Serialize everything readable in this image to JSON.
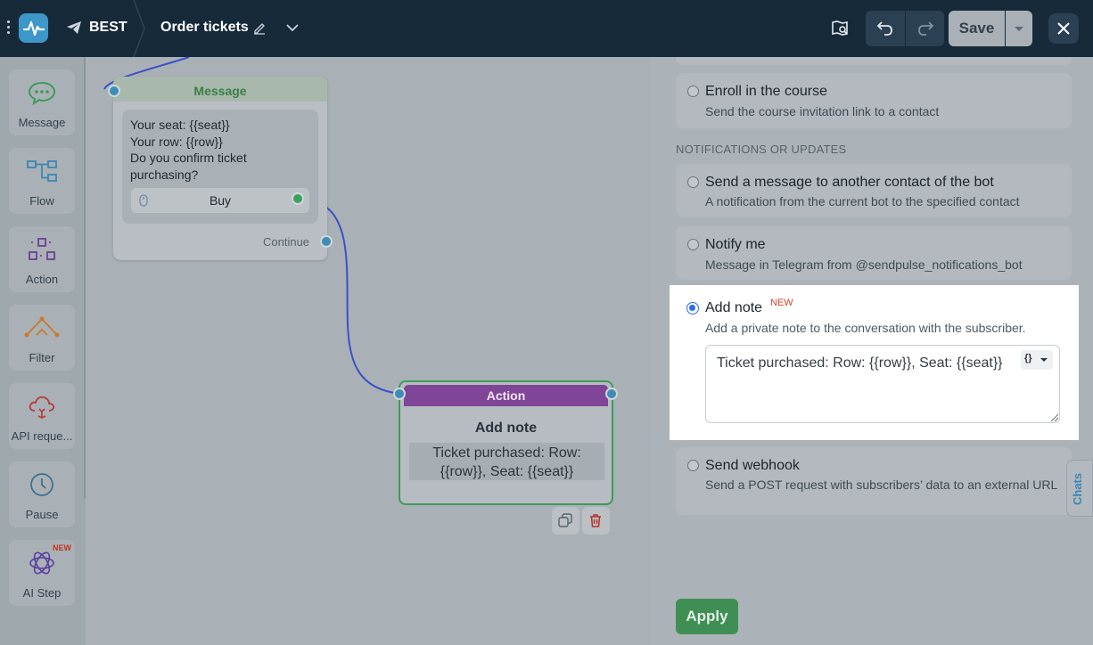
{
  "header": {
    "bot_name": "BEST",
    "flow_title": "Order tickets",
    "save_label": "Save"
  },
  "sidebar": {
    "items": [
      {
        "label": "Message",
        "icon": "message-bubble-icon"
      },
      {
        "label": "Flow",
        "icon": "flow-icon"
      },
      {
        "label": "Action",
        "icon": "action-icon"
      },
      {
        "label": "Filter",
        "icon": "filter-icon"
      },
      {
        "label": "API reque...",
        "icon": "api-cloud-icon"
      },
      {
        "label": "Pause",
        "icon": "clock-icon"
      },
      {
        "label": "AI Step",
        "icon": "ai-flower-icon",
        "badge": "NEW"
      }
    ]
  },
  "canvas": {
    "message_node": {
      "header": "Message",
      "lines": [
        "Your seat: {{seat}}",
        "Your row: {{row}}",
        "Do you confirm ticket",
        "purchasing?"
      ],
      "button_label": "Buy",
      "continue_label": "Continue"
    },
    "action_node": {
      "header": "Action",
      "title": "Add note",
      "note_lines": [
        "Ticket purchased: Row:",
        "{{row}}, Seat: {{seat}}"
      ]
    }
  },
  "panel": {
    "options_top": [
      {
        "title": "Enroll in the course",
        "desc": "Send the course invitation link to a contact"
      }
    ],
    "section_notifications": "NOTIFICATIONS OR UPDATES",
    "options_notifications": [
      {
        "title": "Send a message to another contact of the bot",
        "desc": "A notification from the current bot to the specified contact"
      },
      {
        "title": "Notify me",
        "desc": "Message in Telegram from @sendpulse_notifications_bot"
      }
    ],
    "add_note": {
      "title": "Add note",
      "badge": "NEW",
      "desc": "Add a private note to the conversation with the subscriber.",
      "value": "Ticket purchased: Row: {{row}}, Seat: {{seat}}",
      "var_button": "{}"
    },
    "webhook": {
      "title": "Send webhook",
      "desc": "Send a POST request with subscribers’ data to an external URL"
    },
    "apply_label": "Apply",
    "chats_tab": "Chats"
  },
  "colors": {
    "topbar": "#172a3a",
    "logo": "#3d97c9",
    "message_accent": "#3b7e48",
    "action_header": "#7f4597",
    "apply": "#3f8f55",
    "radio_selected": "#2a6fdb",
    "new_badge": "#e0422a"
  }
}
